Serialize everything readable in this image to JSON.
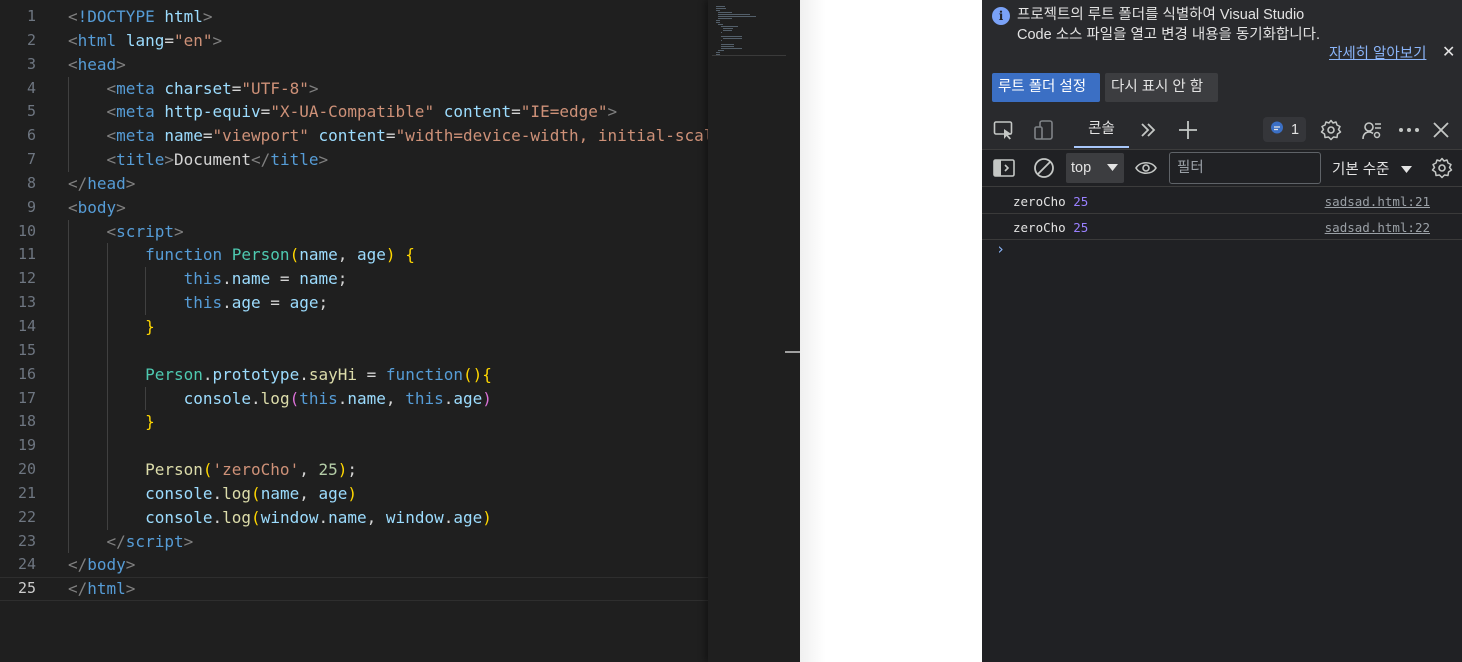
{
  "editor": {
    "lines": [
      {
        "n": "1",
        "indent": 0,
        "toks": [
          [
            "tok-punc",
            "<"
          ],
          [
            "tok-tag",
            "!DOCTYPE"
          ],
          [
            "tok-text",
            " "
          ],
          [
            "tok-attr",
            "html"
          ],
          [
            "tok-punc",
            ">"
          ]
        ]
      },
      {
        "n": "2",
        "indent": 0,
        "toks": [
          [
            "tok-punc",
            "<"
          ],
          [
            "tok-tag",
            "html"
          ],
          [
            "tok-text",
            " "
          ],
          [
            "tok-attr",
            "lang"
          ],
          [
            "tok-text",
            "="
          ],
          [
            "tok-str",
            "\"en\""
          ],
          [
            "tok-punc",
            ">"
          ]
        ]
      },
      {
        "n": "3",
        "indent": 0,
        "toks": [
          [
            "tok-punc",
            "<"
          ],
          [
            "tok-tag",
            "head"
          ],
          [
            "tok-punc",
            ">"
          ]
        ]
      },
      {
        "n": "4",
        "indent": 1,
        "toks": [
          [
            "tok-text",
            "    "
          ],
          [
            "tok-punc",
            "<"
          ],
          [
            "tok-tag",
            "meta"
          ],
          [
            "tok-text",
            " "
          ],
          [
            "tok-attr",
            "charset"
          ],
          [
            "tok-text",
            "="
          ],
          [
            "tok-str",
            "\"UTF-8\""
          ],
          [
            "tok-punc",
            ">"
          ]
        ]
      },
      {
        "n": "5",
        "indent": 1,
        "toks": [
          [
            "tok-text",
            "    "
          ],
          [
            "tok-punc",
            "<"
          ],
          [
            "tok-tag",
            "meta"
          ],
          [
            "tok-text",
            " "
          ],
          [
            "tok-attr",
            "http-equiv"
          ],
          [
            "tok-text",
            "="
          ],
          [
            "tok-str",
            "\"X-UA-Compatible\""
          ],
          [
            "tok-text",
            " "
          ],
          [
            "tok-attr",
            "content"
          ],
          [
            "tok-text",
            "="
          ],
          [
            "tok-str",
            "\"IE=edge\""
          ],
          [
            "tok-punc",
            ">"
          ]
        ]
      },
      {
        "n": "6",
        "indent": 1,
        "toks": [
          [
            "tok-text",
            "    "
          ],
          [
            "tok-punc",
            "<"
          ],
          [
            "tok-tag",
            "meta"
          ],
          [
            "tok-text",
            " "
          ],
          [
            "tok-attr",
            "name"
          ],
          [
            "tok-text",
            "="
          ],
          [
            "tok-str",
            "\"viewport\""
          ],
          [
            "tok-text",
            " "
          ],
          [
            "tok-attr",
            "content"
          ],
          [
            "tok-text",
            "="
          ],
          [
            "tok-str",
            "\"width=device-width, initial-scal"
          ]
        ]
      },
      {
        "n": "7",
        "indent": 1,
        "toks": [
          [
            "tok-text",
            "    "
          ],
          [
            "tok-punc",
            "<"
          ],
          [
            "tok-tag",
            "title"
          ],
          [
            "tok-punc",
            ">"
          ],
          [
            "tok-text",
            "Document"
          ],
          [
            "tok-punc",
            "</"
          ],
          [
            "tok-tag",
            "title"
          ],
          [
            "tok-punc",
            ">"
          ]
        ]
      },
      {
        "n": "8",
        "indent": 0,
        "toks": [
          [
            "tok-punc",
            "</"
          ],
          [
            "tok-tag",
            "head"
          ],
          [
            "tok-punc",
            ">"
          ]
        ]
      },
      {
        "n": "9",
        "indent": 0,
        "toks": [
          [
            "tok-punc",
            "<"
          ],
          [
            "tok-tag",
            "body"
          ],
          [
            "tok-punc",
            ">"
          ]
        ]
      },
      {
        "n": "10",
        "indent": 1,
        "toks": [
          [
            "tok-text",
            "    "
          ],
          [
            "tok-punc",
            "<"
          ],
          [
            "tok-tag",
            "script"
          ],
          [
            "tok-punc",
            ">"
          ]
        ]
      },
      {
        "n": "11",
        "indent": 2,
        "toks": [
          [
            "tok-text",
            "        "
          ],
          [
            "tok-kw",
            "function"
          ],
          [
            "tok-text",
            " "
          ],
          [
            "tok-cls",
            "Person"
          ],
          [
            "tok-b1",
            "("
          ],
          [
            "tok-var",
            "name"
          ],
          [
            "tok-text",
            ", "
          ],
          [
            "tok-var",
            "age"
          ],
          [
            "tok-b1",
            ")"
          ],
          [
            "tok-text",
            " "
          ],
          [
            "tok-b1",
            "{"
          ]
        ]
      },
      {
        "n": "12",
        "indent": 3,
        "toks": [
          [
            "tok-text",
            "            "
          ],
          [
            "tok-kw",
            "this"
          ],
          [
            "tok-text",
            "."
          ],
          [
            "tok-var",
            "name"
          ],
          [
            "tok-text",
            " = "
          ],
          [
            "tok-var",
            "name"
          ],
          [
            "tok-text",
            ";"
          ]
        ]
      },
      {
        "n": "13",
        "indent": 3,
        "toks": [
          [
            "tok-text",
            "            "
          ],
          [
            "tok-kw",
            "this"
          ],
          [
            "tok-text",
            "."
          ],
          [
            "tok-var",
            "age"
          ],
          [
            "tok-text",
            " = "
          ],
          [
            "tok-var",
            "age"
          ],
          [
            "tok-text",
            ";"
          ]
        ]
      },
      {
        "n": "14",
        "indent": 2,
        "toks": [
          [
            "tok-text",
            "        "
          ],
          [
            "tok-b1",
            "}"
          ]
        ]
      },
      {
        "n": "15",
        "indent": 2,
        "toks": []
      },
      {
        "n": "16",
        "indent": 2,
        "toks": [
          [
            "tok-text",
            "        "
          ],
          [
            "tok-cls",
            "Person"
          ],
          [
            "tok-text",
            "."
          ],
          [
            "tok-var",
            "prototype"
          ],
          [
            "tok-text",
            "."
          ],
          [
            "tok-fn",
            "sayHi"
          ],
          [
            "tok-text",
            " = "
          ],
          [
            "tok-kw",
            "function"
          ],
          [
            "tok-b1",
            "(){"
          ]
        ]
      },
      {
        "n": "17",
        "indent": 3,
        "toks": [
          [
            "tok-text",
            "            "
          ],
          [
            "tok-var",
            "console"
          ],
          [
            "tok-text",
            "."
          ],
          [
            "tok-fn",
            "log"
          ],
          [
            "tok-b2",
            "("
          ],
          [
            "tok-kw",
            "this"
          ],
          [
            "tok-text",
            "."
          ],
          [
            "tok-var",
            "name"
          ],
          [
            "tok-text",
            ", "
          ],
          [
            "tok-kw",
            "this"
          ],
          [
            "tok-text",
            "."
          ],
          [
            "tok-var",
            "age"
          ],
          [
            "tok-b2",
            ")"
          ]
        ]
      },
      {
        "n": "18",
        "indent": 2,
        "toks": [
          [
            "tok-text",
            "        "
          ],
          [
            "tok-b1",
            "}"
          ]
        ]
      },
      {
        "n": "19",
        "indent": 2,
        "toks": []
      },
      {
        "n": "20",
        "indent": 2,
        "toks": [
          [
            "tok-text",
            "        "
          ],
          [
            "tok-fn",
            "Person"
          ],
          [
            "tok-b1",
            "("
          ],
          [
            "tok-str",
            "'zeroCho'"
          ],
          [
            "tok-text",
            ", "
          ],
          [
            "tok-num",
            "25"
          ],
          [
            "tok-b1",
            ")"
          ],
          [
            "tok-text",
            ";"
          ]
        ]
      },
      {
        "n": "21",
        "indent": 2,
        "toks": [
          [
            "tok-text",
            "        "
          ],
          [
            "tok-var",
            "console"
          ],
          [
            "tok-text",
            "."
          ],
          [
            "tok-fn",
            "log"
          ],
          [
            "tok-b1",
            "("
          ],
          [
            "tok-var",
            "name"
          ],
          [
            "tok-text",
            ", "
          ],
          [
            "tok-var",
            "age"
          ],
          [
            "tok-b1",
            ")"
          ]
        ]
      },
      {
        "n": "22",
        "indent": 2,
        "toks": [
          [
            "tok-text",
            "        "
          ],
          [
            "tok-var",
            "console"
          ],
          [
            "tok-text",
            "."
          ],
          [
            "tok-fn",
            "log"
          ],
          [
            "tok-b1",
            "("
          ],
          [
            "tok-var",
            "window"
          ],
          [
            "tok-text",
            "."
          ],
          [
            "tok-var",
            "name"
          ],
          [
            "tok-text",
            ", "
          ],
          [
            "tok-var",
            "window"
          ],
          [
            "tok-text",
            "."
          ],
          [
            "tok-var",
            "age"
          ],
          [
            "tok-b1",
            ")"
          ]
        ]
      },
      {
        "n": "23",
        "indent": 1,
        "toks": [
          [
            "tok-text",
            "    "
          ],
          [
            "tok-punc",
            "</"
          ],
          [
            "tok-tag",
            "script"
          ],
          [
            "tok-punc",
            ">"
          ]
        ]
      },
      {
        "n": "24",
        "indent": 0,
        "toks": [
          [
            "tok-punc",
            "</"
          ],
          [
            "tok-tag",
            "body"
          ],
          [
            "tok-punc",
            ">"
          ]
        ]
      },
      {
        "n": "25",
        "indent": 0,
        "toks": [
          [
            "tok-punc",
            "</"
          ],
          [
            "tok-tag",
            "html"
          ],
          [
            "tok-punc",
            ">"
          ]
        ],
        "current": true
      }
    ]
  },
  "devtools": {
    "infobar": {
      "message": "프로젝트의 루트 폴더를 식별하여 Visual Studio Code 소스 파일을 열고 변경 내용을 동기화합니다.",
      "learn_more": "자세히 알아보기",
      "primary_button": "루트 폴더 설정",
      "secondary_button": "다시 표시 안 함"
    },
    "tabs": {
      "console_label": "콘솔",
      "issues_count": "1"
    },
    "toolbar": {
      "context": "top",
      "filter_placeholder": "필터",
      "levels": "기본 수준"
    },
    "console": {
      "messages": [
        {
          "text": "zeroCho",
          "number": "25",
          "source": "sadsad.html:21"
        },
        {
          "text": "zeroCho",
          "number": "25",
          "source": "sadsad.html:22"
        }
      ],
      "prompt": "›"
    }
  },
  "icons": {
    "inspect": "inspect-element-icon",
    "device": "device-toolbar-icon",
    "more_tabs": "chevron-double-right-icon",
    "add": "plus-icon",
    "issues": "message-bubble-icon",
    "settings": "gear-icon",
    "customize": "customize-icon",
    "more": "more-options-icon",
    "close": "close-icon",
    "sidebar": "sidebar-toggle-icon",
    "clear": "clear-console-icon",
    "eye": "live-expression-icon"
  },
  "colors": {
    "editor_bg": "#1f1f1f",
    "devtools_bg": "#202124",
    "accent": "#3b6fc4",
    "link": "#8ab4f8"
  }
}
